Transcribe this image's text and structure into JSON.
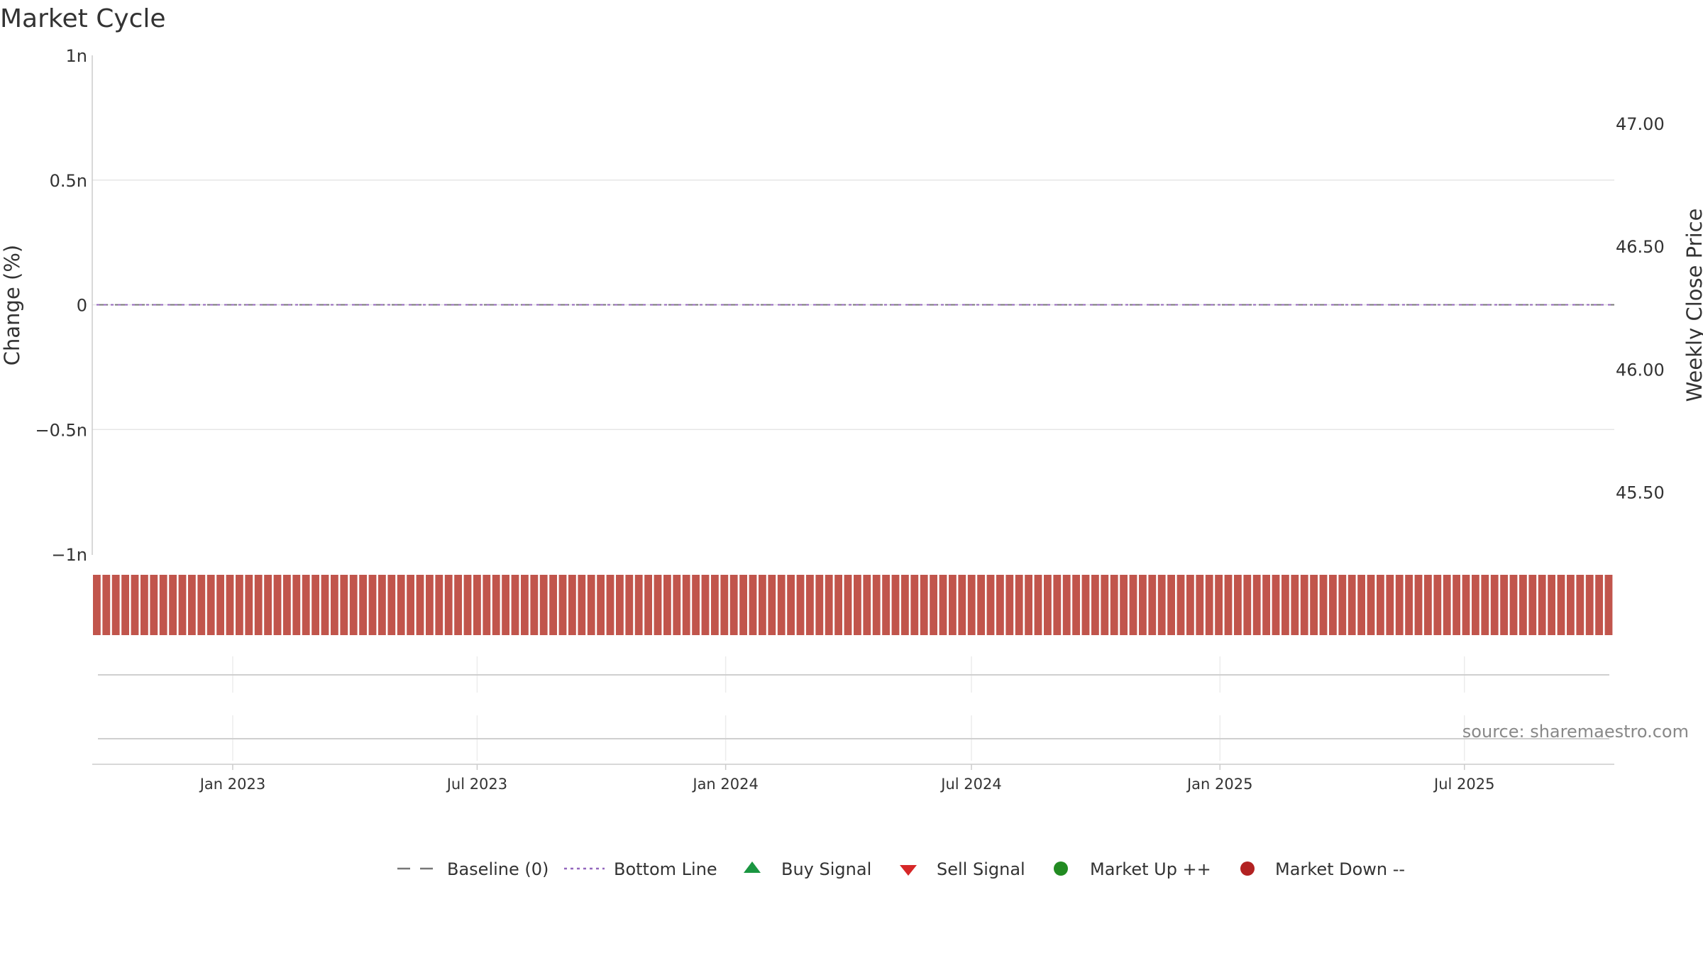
{
  "chart_data": {
    "type": "bar",
    "title": "Market Cycle",
    "ylabel": "Change (%)",
    "y2label": "Weekly Close Price",
    "source": "source: sharemaestro.com",
    "y_ticks": [
      "1n",
      "0.5n",
      "0",
      "−0.5n",
      "−1n"
    ],
    "y_tick_values": [
      1,
      0.5,
      0,
      -0.5,
      -1
    ],
    "ylim": [
      -1,
      1
    ],
    "y2_ticks": [
      "47.00",
      "46.50",
      "46.00",
      "45.50"
    ],
    "y2_tick_values": [
      47.0,
      46.5,
      46.0,
      45.5
    ],
    "y2lim": [
      45.25,
      47.28
    ],
    "x_start": "2022-09-19",
    "x_end": "2025-10-20",
    "x_ticks": [
      {
        "label": "Jan 2023",
        "date": "2023-01-01"
      },
      {
        "label": "Jul 2023",
        "date": "2023-07-01"
      },
      {
        "label": "Jan 2024",
        "date": "2024-01-01"
      },
      {
        "label": "Jul 2024",
        "date": "2024-07-01"
      },
      {
        "label": "Jan 2025",
        "date": "2025-01-01"
      },
      {
        "label": "Jul 2025",
        "date": "2025-07-01"
      }
    ],
    "series": [
      {
        "name": "Baseline (0)",
        "type": "line",
        "value": 0,
        "color": "#777777"
      },
      {
        "name": "Bottom Line",
        "type": "line",
        "value": 0,
        "color": "#9467bd"
      },
      {
        "name": "Buy Signal",
        "type": "scatter",
        "color": "#1a9641"
      },
      {
        "name": "Sell Signal",
        "type": "scatter",
        "color": "#d62728"
      },
      {
        "name": "Market Up ++",
        "type": "scatter",
        "color": "#228b22"
      },
      {
        "name": "Market Down --",
        "type": "bar",
        "color": "#c1554c",
        "count": 160
      }
    ],
    "grid": true,
    "legend_position": "bottom"
  }
}
